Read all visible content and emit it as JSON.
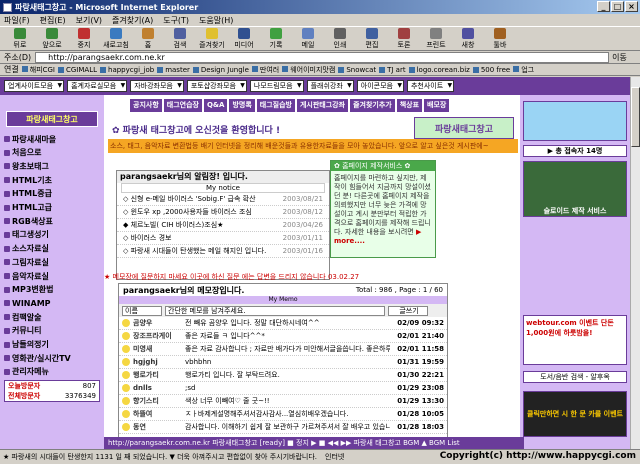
{
  "window": {
    "title": "파랑새태그창고 - Microsoft Internet Explorer",
    "buttons": [
      "_",
      "□",
      "×"
    ]
  },
  "menu": [
    "파일(F)",
    "편집(E)",
    "보기(V)",
    "즐겨찾기(A)",
    "도구(T)",
    "도움말(H)"
  ],
  "toolbar": [
    {
      "label": "뒤로",
      "color": "#3a8a3a"
    },
    {
      "label": "앞으로",
      "color": "#3a8a3a"
    },
    {
      "label": "중지",
      "color": "#c03030"
    },
    {
      "label": "새로고침",
      "color": "#3a7ac0"
    },
    {
      "label": "홈",
      "color": "#c08030"
    },
    {
      "label": "검색",
      "color": "#5060a0"
    },
    {
      "label": "즐겨찾기",
      "color": "#e0c030"
    },
    {
      "label": "미디어",
      "color": "#305090"
    },
    {
      "label": "기록",
      "color": "#40a040"
    },
    {
      "label": "메일",
      "color": "#6080c0"
    },
    {
      "label": "인쇄",
      "color": "#606060"
    },
    {
      "label": "편집",
      "color": "#4060a0"
    },
    {
      "label": "토론",
      "color": "#a04040"
    },
    {
      "label": "프린트",
      "color": "#808080"
    },
    {
      "label": "새창",
      "color": "#5050a0"
    },
    {
      "label": "툴바",
      "color": "#a06020"
    }
  ],
  "address": {
    "label": "주소(D)",
    "url": "http://parangsaekr.com.ne.kr",
    "go": "이동"
  },
  "links": {
    "label": "연결",
    "items": [
      "해피CGI",
      "CGIMALL",
      "happycgi_job",
      "master",
      "Design Jungle",
      "딴여러",
      "웨어이미지맛캠",
      "Snowcat",
      "TJ art",
      "logo.corean.biz",
      "500 free",
      "업그"
    ]
  },
  "page": {
    "selects": [
      "업계사이트모음",
      "홈계자료실모음",
      "자바강좌모음",
      "포토샵강좌모음",
      "나모드림모음",
      "플래쉬강좌",
      "아이콘모음",
      "추천사이트"
    ],
    "logo": "파랑새태그창고",
    "nav": [
      "파랑새새마을",
      "처음으로",
      "왕초보태그",
      "HTML기초",
      "HTML중급",
      "HTML고급",
      "RGB색상표",
      "태그생성기",
      "소스자료실",
      "그림자료실",
      "음악자료실",
      "MP3변환법",
      "WINAMP",
      "컴팩알술",
      "커뮤니티",
      "남들의정기",
      "영화관/실시간TV",
      "관리자메뉴"
    ],
    "counter": {
      "today_label": "오늘방문자",
      "today": "807",
      "total_label": "전체방문자",
      "total": "3376349"
    },
    "topnav": [
      "공지사항",
      "태그연습장",
      "Q&A",
      "방명록",
      "태그질습방",
      "게시판태그강좌",
      "즐겨찾기추가",
      "책상표",
      "배모장"
    ],
    "welcome": "✿ 파랑새 태그창고에 오신것을 환영합니다 !",
    "ribbon": "소스, 태그, 음악자료 변환법등 배기 인터넷을 정리해 배운것들과 유용한자료들을 모아 놓았습니다. 앞으로 알고 싶은것 게시판에~",
    "sitelogo": "파랑새태그창고",
    "notice": {
      "title": "parangsaekr님의 알림장! 입니다.",
      "subtitle": "My notice",
      "rows": [
        {
          "t": "◇ 신형 e-메일 바이러스 'Sobig.F' 급속 확산",
          "d": "2003/08/21"
        },
        {
          "t": "◇ 윈도우 xp ,2000사용자들 바이러스 조심",
          "d": "2003/08/12"
        },
        {
          "t": "◆ 체르노빌( CIH 바이러스)조심★",
          "d": "2003/04/26"
        },
        {
          "t": "◇ 바이러스 경보",
          "d": "2003/01/11"
        },
        {
          "t": "◇ 파랑새 시대들이 탄생했는 메일 해지인 입니다.",
          "d": "2003/01/16"
        }
      ]
    },
    "promo": {
      "title": "✿ 홈페이지 제작서비스 ✿",
      "text": "홈페이지를 마련하고 싶지만, 제작이 힘들어서 지금까지 망설이셨던 분! 다른곳에 홈페이지 제작을 의뢰했지만 너무 늦은 가격에 망설이고 계시 분만부터 적립한 가격으로 홈페이지를 제작해 드립니다. 자세한 내용을 보시려면",
      "more": "▶ more...."
    },
    "warning": "★ 메모장에 질문하지 마세요 이곳에 하신 질문 에는 답변을 드리지 않습니다 03.02.27",
    "memo": {
      "title": "parangsaekr님의 메모장입니다.",
      "meta": "Total : 986 , Page : 1 / 60",
      "bar": "My Memo",
      "name_ph": "이름",
      "text_ph": "간단한 메모를 남겨주세요.",
      "write": "글쓰기",
      "rows": [
        {
          "n": "곰양우",
          "t": "전 빼유 곰양우 입니다. 정말 대단하시네여^^",
          "d": "02/09 09:32"
        },
        {
          "n": "장조프라게이",
          "t": "좋은 자료들 ㅋ 입니다^^*",
          "d": "02/01 21:40"
        },
        {
          "n": "미영새",
          "t": "좋은 자료 감사합니다 ; 자료만 배가다가 미안해서글을씁니다. 좋은하루되세요",
          "d": "02/01 11:58"
        },
        {
          "n": "hgjghj",
          "t": "vbhbhn",
          "d": "01/31 19:59"
        },
        {
          "n": "행로가티",
          "t": "행로가티 입니다. 잘 부탁드려요.",
          "d": "01/30 22:21"
        },
        {
          "n": "dnlls",
          "t": ";sd",
          "d": "01/29 23:08"
        },
        {
          "n": "향기스티",
          "t": "색상 너무 이빼여♡ 줄 굿~!!",
          "d": "01/29 13:30"
        },
        {
          "n": "하뜰여",
          "t": "ㅈㅏ바제계설명해주셔서감사감사...열심히배우겠습니다.",
          "d": "01/28 10:05"
        },
        {
          "n": "동연",
          "t": "감사합니다. 이해하기 쉽게 잘 보관하구 가르쳐주셔서 잘 배우고 있습니다.",
          "d": "01/28 18:03"
        }
      ]
    },
    "right": {
      "box1": "▶ 총 접속자 14명",
      "box2": "슬로이드 제작 서비스",
      "box3": "webtour.com 이벤트 단돈 1,000원에 하룻밤을!",
      "box4": "도서/음반 검색 - 알후옥",
      "box5": "클릭만하면 시 한 문 카를 이벤트"
    },
    "player": "http://parangsaekr.com.ne.kr 파랑새태그창고 [ready]  ■ 정지 ▶ ■ ◀◀ ▶▶ 파랑새 태그창고 BGM  ▲ BGM List"
  },
  "status": {
    "text": "★ 파랑새의 시대들이 탄생한지 1131 일 째 되었습니다.  ▼ 더욱 아껴주시고 편합없이 찾아 주시기바랍니다.",
    "zone": "인터넷",
    "copyright": "Copyright(c) http://www.happycgi.com"
  }
}
